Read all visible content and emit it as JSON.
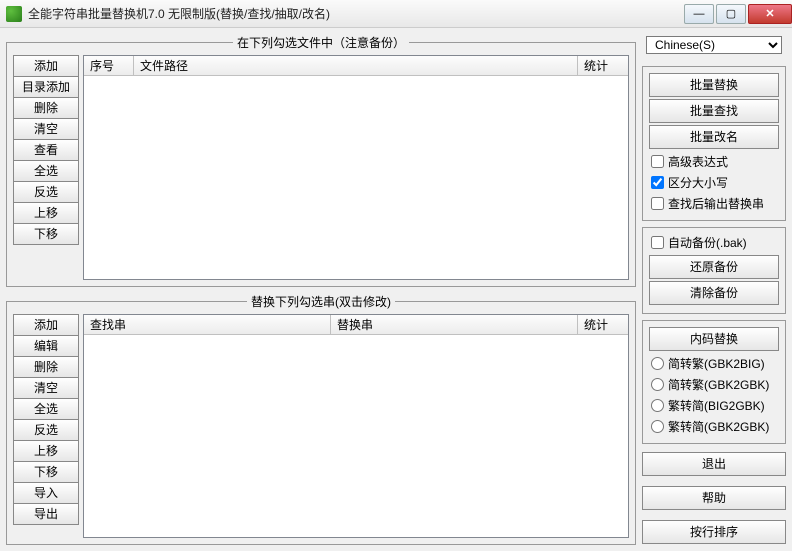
{
  "window": {
    "title": "全能字符串批量替换机7.0 无限制版(替换/查找/抽取/改名)"
  },
  "fs1": {
    "legend": "在下列勾选文件中（注意备份）",
    "buttons": [
      "添加",
      "目录添加",
      "删除",
      "清空",
      "查看",
      "全选",
      "反选",
      "上移",
      "下移"
    ],
    "cols": {
      "c1": "序号",
      "c2": "文件路径",
      "c3": "统计"
    }
  },
  "fs2": {
    "legend": "替换下列勾选串(双击修改)",
    "buttons": [
      "添加",
      "编辑",
      "删除",
      "清空",
      "全选",
      "反选",
      "上移",
      "下移",
      "导入",
      "导出"
    ],
    "cols": {
      "c1": "查找串",
      "c2": "替换串",
      "c3": "统计"
    }
  },
  "right": {
    "lang_selected": "Chinese(S)",
    "batch": {
      "replace": "批量替换",
      "find": "批量查找",
      "rename": "批量改名"
    },
    "opts": {
      "regex": "高级表达式",
      "case": "区分大小写",
      "output": "查找后输出替换串",
      "regex_checked": false,
      "case_checked": true,
      "output_checked": false
    },
    "backup": {
      "auto": "自动备份(.bak)",
      "auto_checked": false,
      "restore": "还原备份",
      "clear": "清除备份"
    },
    "encode": {
      "title": "内码替换",
      "r1": "简转繁(GBK2BIG)",
      "r2": "简转繁(GBK2GBK)",
      "r3": "繁转简(BIG2GBK)",
      "r4": "繁转简(GBK2GBK)"
    },
    "exit": "退出",
    "help": "帮助",
    "sort": "按行排序"
  }
}
